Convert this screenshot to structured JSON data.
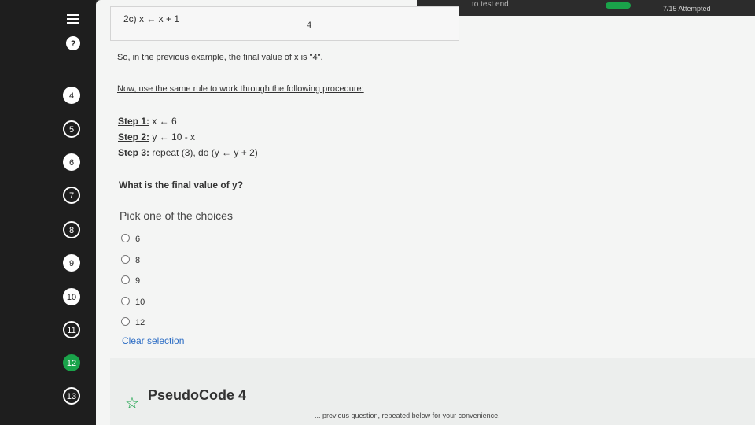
{
  "sidebar": {
    "menu_icon": "menu-icon",
    "help_label": "?",
    "questions": [
      "4",
      "5",
      "6",
      "7",
      "8",
      "9",
      "10",
      "11",
      "12",
      "13"
    ],
    "current": "12"
  },
  "top": {
    "test_end": "to test end",
    "attempted": "7/15 Attempted"
  },
  "previous_example": {
    "step": "2c) x ← x + 1",
    "value": "4"
  },
  "question": {
    "intro": "So, in the previous example, the final value of x is \"4\".",
    "rule": "Now, use the same rule to work through the following procedure:",
    "steps": [
      {
        "label": "Step 1:",
        "text": " x ← 6"
      },
      {
        "label": "Step 2:",
        "text": " y ← 10 - x"
      },
      {
        "label": "Step 3:",
        "text": " repeat (3), do (y ← y + 2)"
      }
    ],
    "prompt": "What is the final value of y?",
    "pick_label": "Pick one of the choices",
    "choices": [
      "6",
      "8",
      "9",
      "10",
      "12"
    ],
    "clear_label": "Clear selection"
  },
  "next_section": {
    "star_icon": "star-outline-icon",
    "title": "PseudoCode 4",
    "note": "... previous question, repeated below for your convenience."
  },
  "colors": {
    "accent": "#1aa34a",
    "link": "#2b6cc4"
  }
}
